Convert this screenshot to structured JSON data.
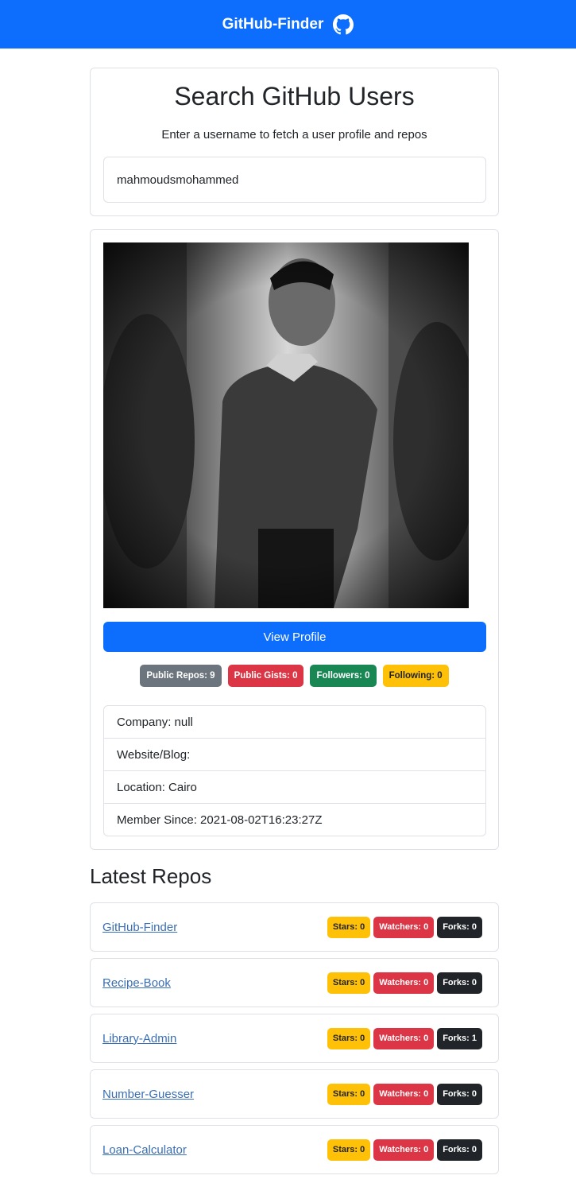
{
  "navbar": {
    "brand": "GitHub-Finder",
    "icon": "github-icon",
    "color": "#0d6efd"
  },
  "search": {
    "title": "Search GitHub Users",
    "subtitle": "Enter a username to fetch a user profile and repos",
    "value": "mahmoudsmohammed"
  },
  "profile": {
    "avatar_icon": "user-avatar-photo",
    "view_button": "View Profile",
    "badges": {
      "repos": "Public Repos: 9",
      "gists": "Public Gists: 0",
      "followers": "Followers: 0",
      "following": "Following: 0"
    },
    "details": {
      "company": "Company: null",
      "website": "Website/Blog:",
      "location": "Location: Cairo",
      "member_since": "Member Since: 2021-08-02T16:23:27Z"
    }
  },
  "repos": {
    "heading": "Latest Repos",
    "items": [
      {
        "name": "GitHub-Finder",
        "stars": "Stars: 0",
        "watchers": "Watchers: 0",
        "forks": "Forks: 0"
      },
      {
        "name": "Recipe-Book",
        "stars": "Stars: 0",
        "watchers": "Watchers: 0",
        "forks": "Forks: 0"
      },
      {
        "name": "Library-Admin",
        "stars": "Stars: 0",
        "watchers": "Watchers: 0",
        "forks": "Forks: 1"
      },
      {
        "name": "Number-Guesser",
        "stars": "Stars: 0",
        "watchers": "Watchers: 0",
        "forks": "Forks: 0"
      },
      {
        "name": "Loan-Calculator",
        "stars": "Stars: 0",
        "watchers": "Watchers: 0",
        "forks": "Forks: 0"
      }
    ]
  }
}
